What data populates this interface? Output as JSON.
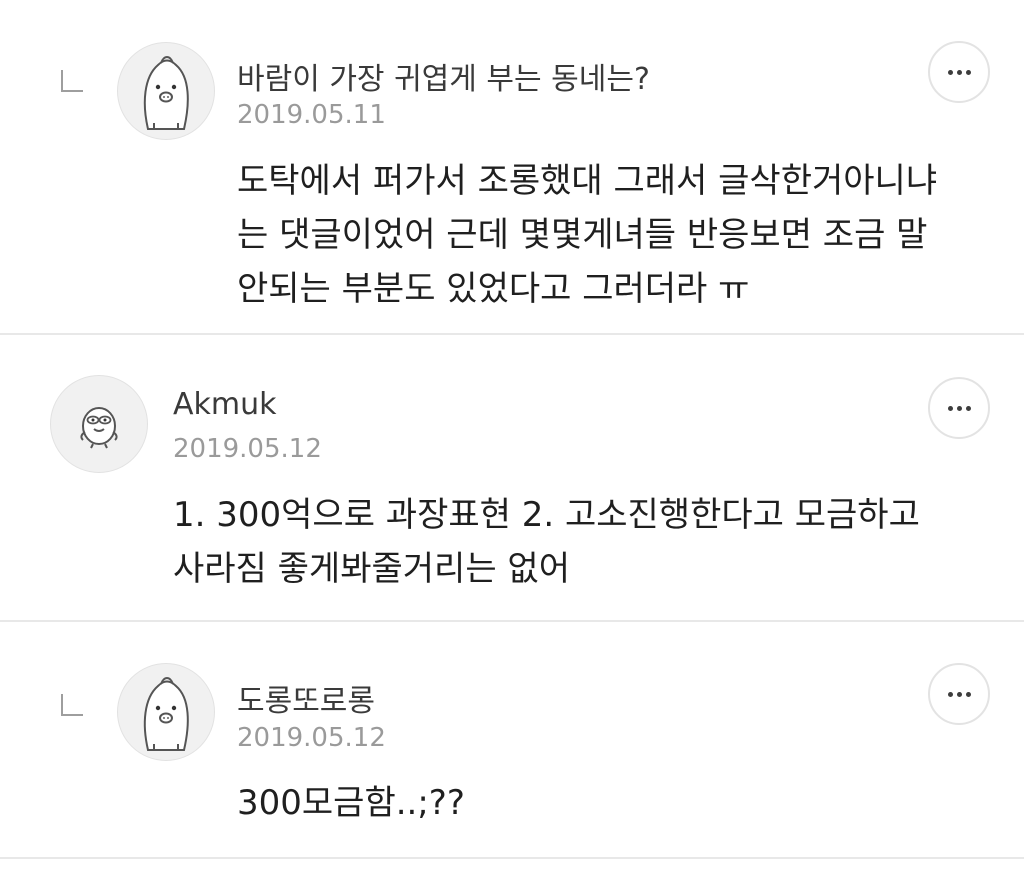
{
  "comments": [
    {
      "is_reply": true,
      "author": "바람이 가장 귀엽게 부는 동네는?",
      "date": "2019.05.11",
      "text": "도탁에서 퍼가서 조롱했대 그래서 글삭한거아니냐\n는 댓글이었어 근데 몇몇게녀들 반응보면 조금 말\n안되는 부분도 있었다고 그러더라 ㅠ",
      "avatar_icon": "penguin-avatar-icon",
      "more_icon": "more-options-icon"
    },
    {
      "is_reply": false,
      "author": "Akmuk",
      "date": "2019.05.12",
      "text": "1. 300억으로 과장표현 2. 고소진행한다고 모금하고\n사라짐 좋게봐줄거리는 없어",
      "avatar_icon": "bird-avatar-icon",
      "more_icon": "more-options-icon"
    },
    {
      "is_reply": true,
      "author": "도롱또로롱",
      "date": "2019.05.12",
      "text": "300모금함..;??",
      "avatar_icon": "penguin-avatar-icon",
      "more_icon": "more-options-icon"
    }
  ],
  "colors": {
    "divider": "#e8e8e8",
    "author": "#3a3a3a",
    "date": "#9a9a9a",
    "body": "#1f1f1f",
    "avatar_bg": "#f1f1f1"
  }
}
